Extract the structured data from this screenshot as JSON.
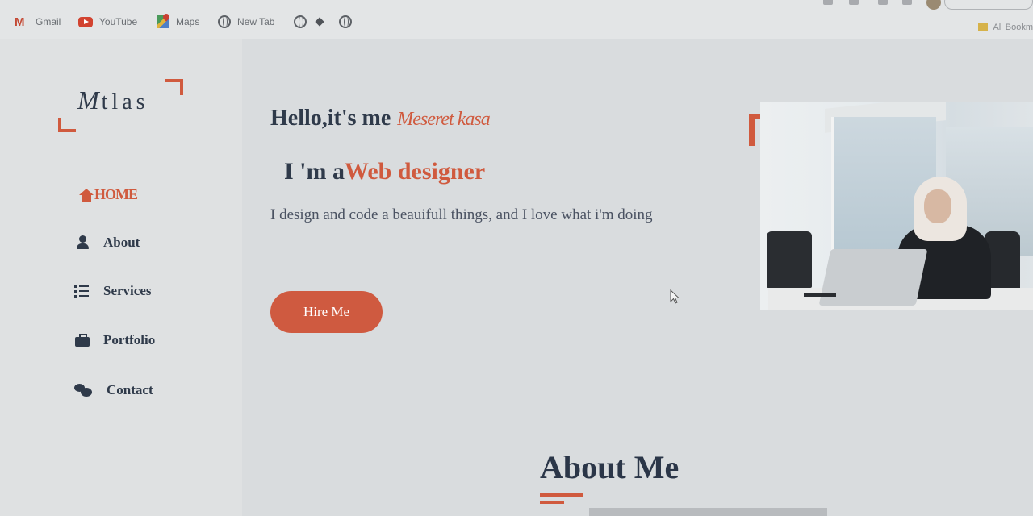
{
  "bookmarks": {
    "items": [
      {
        "label": "Gmail",
        "icon": "gmail-icon"
      },
      {
        "label": "YouTube",
        "icon": "youtube-icon"
      },
      {
        "label": "Maps",
        "icon": "maps-icon"
      },
      {
        "label": "New Tab",
        "icon": "globe-icon"
      }
    ],
    "all_bookmarks": "All Bookm"
  },
  "logo": {
    "first": "M",
    "rest": "tlas"
  },
  "nav": {
    "items": [
      {
        "label": "HOME",
        "icon": "home-icon",
        "active": true
      },
      {
        "label": "About",
        "icon": "user-icon"
      },
      {
        "label": "Services",
        "icon": "list-icon"
      },
      {
        "label": "Portfolio",
        "icon": "briefcase-icon"
      },
      {
        "label": "Contact",
        "icon": "chat-icon"
      }
    ]
  },
  "hero": {
    "greeting": "Hello,it's me",
    "name": "Meseret kasa",
    "role_prefix": "I 'm a",
    "role": "Web designer",
    "tagline": "I design and code a beauifull things, and I love what i'm doing",
    "cta": "Hire Me"
  },
  "about": {
    "title": "About Me"
  },
  "colors": {
    "accent": "#d05a3e",
    "text": "#2f3a4a",
    "button": "#cf5a40"
  }
}
